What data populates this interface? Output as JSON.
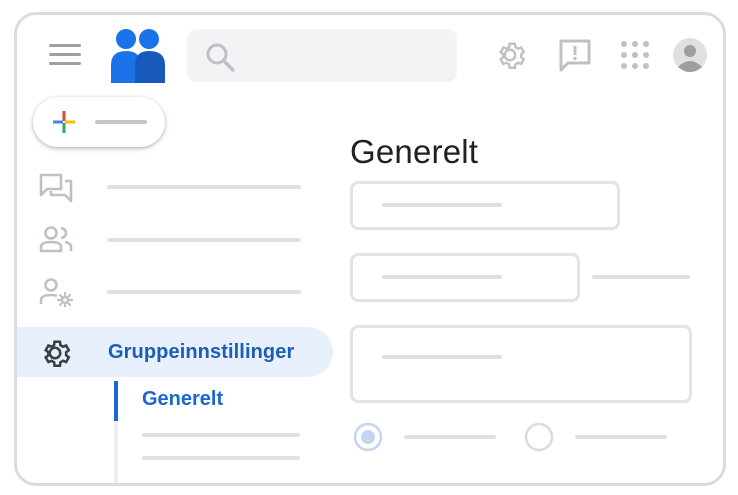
{
  "sidebar": {
    "items": [
      {
        "icon": "chat-icon"
      },
      {
        "icon": "members-icon"
      },
      {
        "icon": "member-settings-icon"
      },
      {
        "icon": "gear-icon",
        "label": "Gruppeinnstillinger"
      }
    ],
    "subitems": [
      {
        "label": "Generelt"
      }
    ]
  },
  "main": {
    "title": "Generelt"
  },
  "colors": {
    "accent": "#1967d2",
    "active_bg": "#e8f0fe",
    "placeholder": "#e0e0e0"
  }
}
